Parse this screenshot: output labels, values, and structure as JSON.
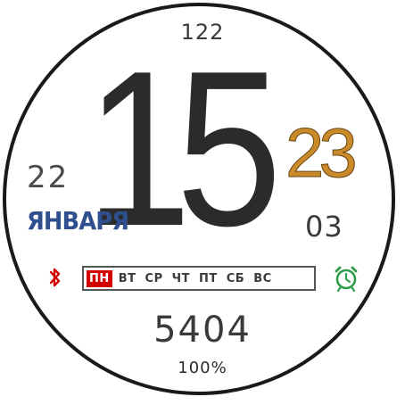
{
  "watch": {
    "top_value": "122",
    "hour": "15",
    "minute": "23",
    "day": "22",
    "month": "ЯНВАРЯ",
    "seconds": "03",
    "weekdays": [
      {
        "label": "ПН",
        "active": true
      },
      {
        "label": "ВТ",
        "active": false
      },
      {
        "label": "СР",
        "active": false
      },
      {
        "label": "ЧТ",
        "active": false
      },
      {
        "label": "ПТ",
        "active": false
      },
      {
        "label": "СБ",
        "active": false
      },
      {
        "label": "ВС",
        "active": false
      }
    ],
    "steps": "5404",
    "battery": "100%",
    "icons": {
      "bluetooth": "bluetooth-icon",
      "alarm": "alarm-icon"
    },
    "colors": {
      "ring": "#1a1a1a",
      "hour": "#2b2b2b",
      "minute": "#c98a2a",
      "month": "#2f4f8f",
      "active_day": "#d40000",
      "bluetooth": "#d40000",
      "alarm": "#2e9e4a"
    }
  }
}
